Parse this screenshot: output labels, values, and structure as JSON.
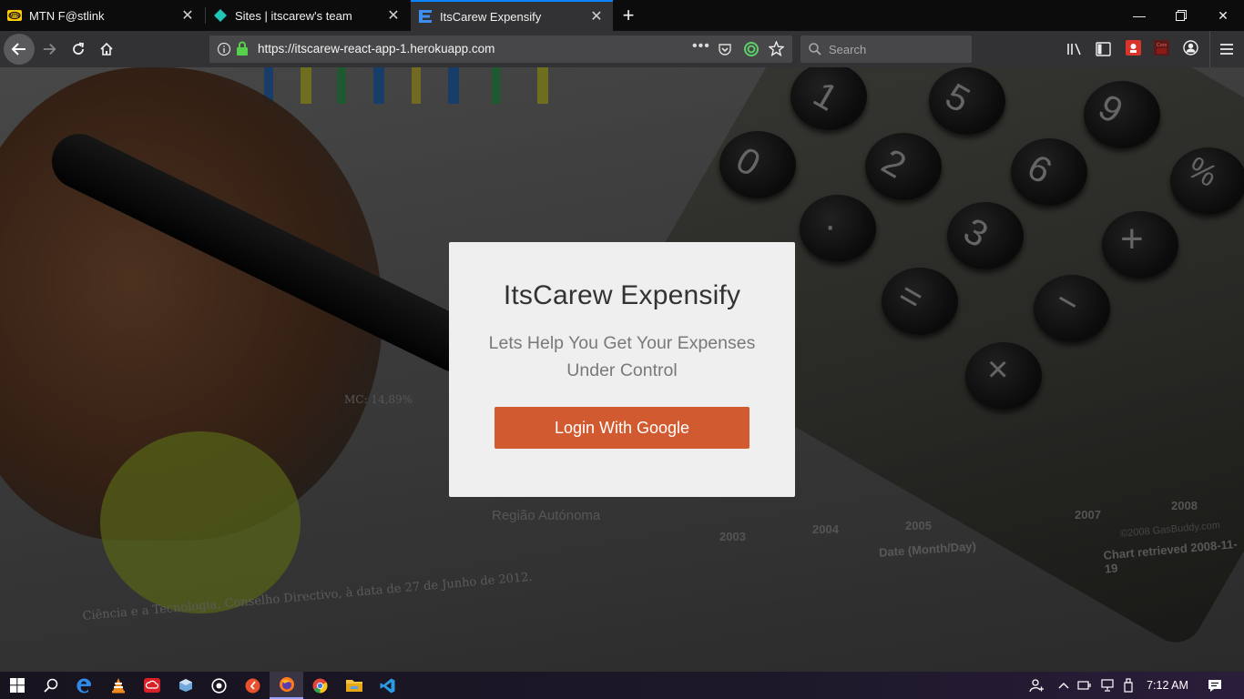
{
  "browser": {
    "tabs": [
      {
        "title": "MTN F@stlink",
        "active": false,
        "favicon": "mtn-icon"
      },
      {
        "title": "Sites | itscarew's team",
        "active": false,
        "favicon": "netlify-diamond-icon"
      },
      {
        "title": "ItsCarew Expensify",
        "active": true,
        "favicon": "expensify-e-icon"
      }
    ],
    "url": "https://itscarew-react-app-1.herokuapp.com",
    "search_placeholder": "Search",
    "accent": "#0a84ff"
  },
  "page": {
    "card": {
      "title": "ItsCarew Expensify",
      "subtitle": "Lets Help You Get Your Expenses Under Control",
      "login_label": "Login With Google",
      "button_color": "#d15a30"
    },
    "background_text": {
      "chart_pct": "MC: 14,89%",
      "legend": "Região Autónoma",
      "footer": "Ciência e a Tecnologia, Conselho Directivo, à data de 27 de Junho de 2012.",
      "years": [
        "2003",
        "2004",
        "2005",
        "2007",
        "2008"
      ],
      "axis_label": "Date (Month/Day)",
      "chart_credit": "Chart retrieved 2008-11-19",
      "copyright": "©2008 GasBuddy.com"
    },
    "calculator_keys": [
      "1",
      "5",
      "9",
      "0",
      "2",
      "6",
      "%",
      "·",
      "3",
      "+",
      "=",
      "−",
      "×"
    ]
  },
  "taskbar": {
    "time": "7:12 AM",
    "apps": [
      "start-icon",
      "search-icon",
      "edge-icon",
      "vlc-icon",
      "creative-cloud-icon",
      "box-icon",
      "camera-icon",
      "opera-icon",
      "firefox-icon",
      "chrome-icon",
      "file-explorer-icon",
      "vscode-icon"
    ]
  }
}
